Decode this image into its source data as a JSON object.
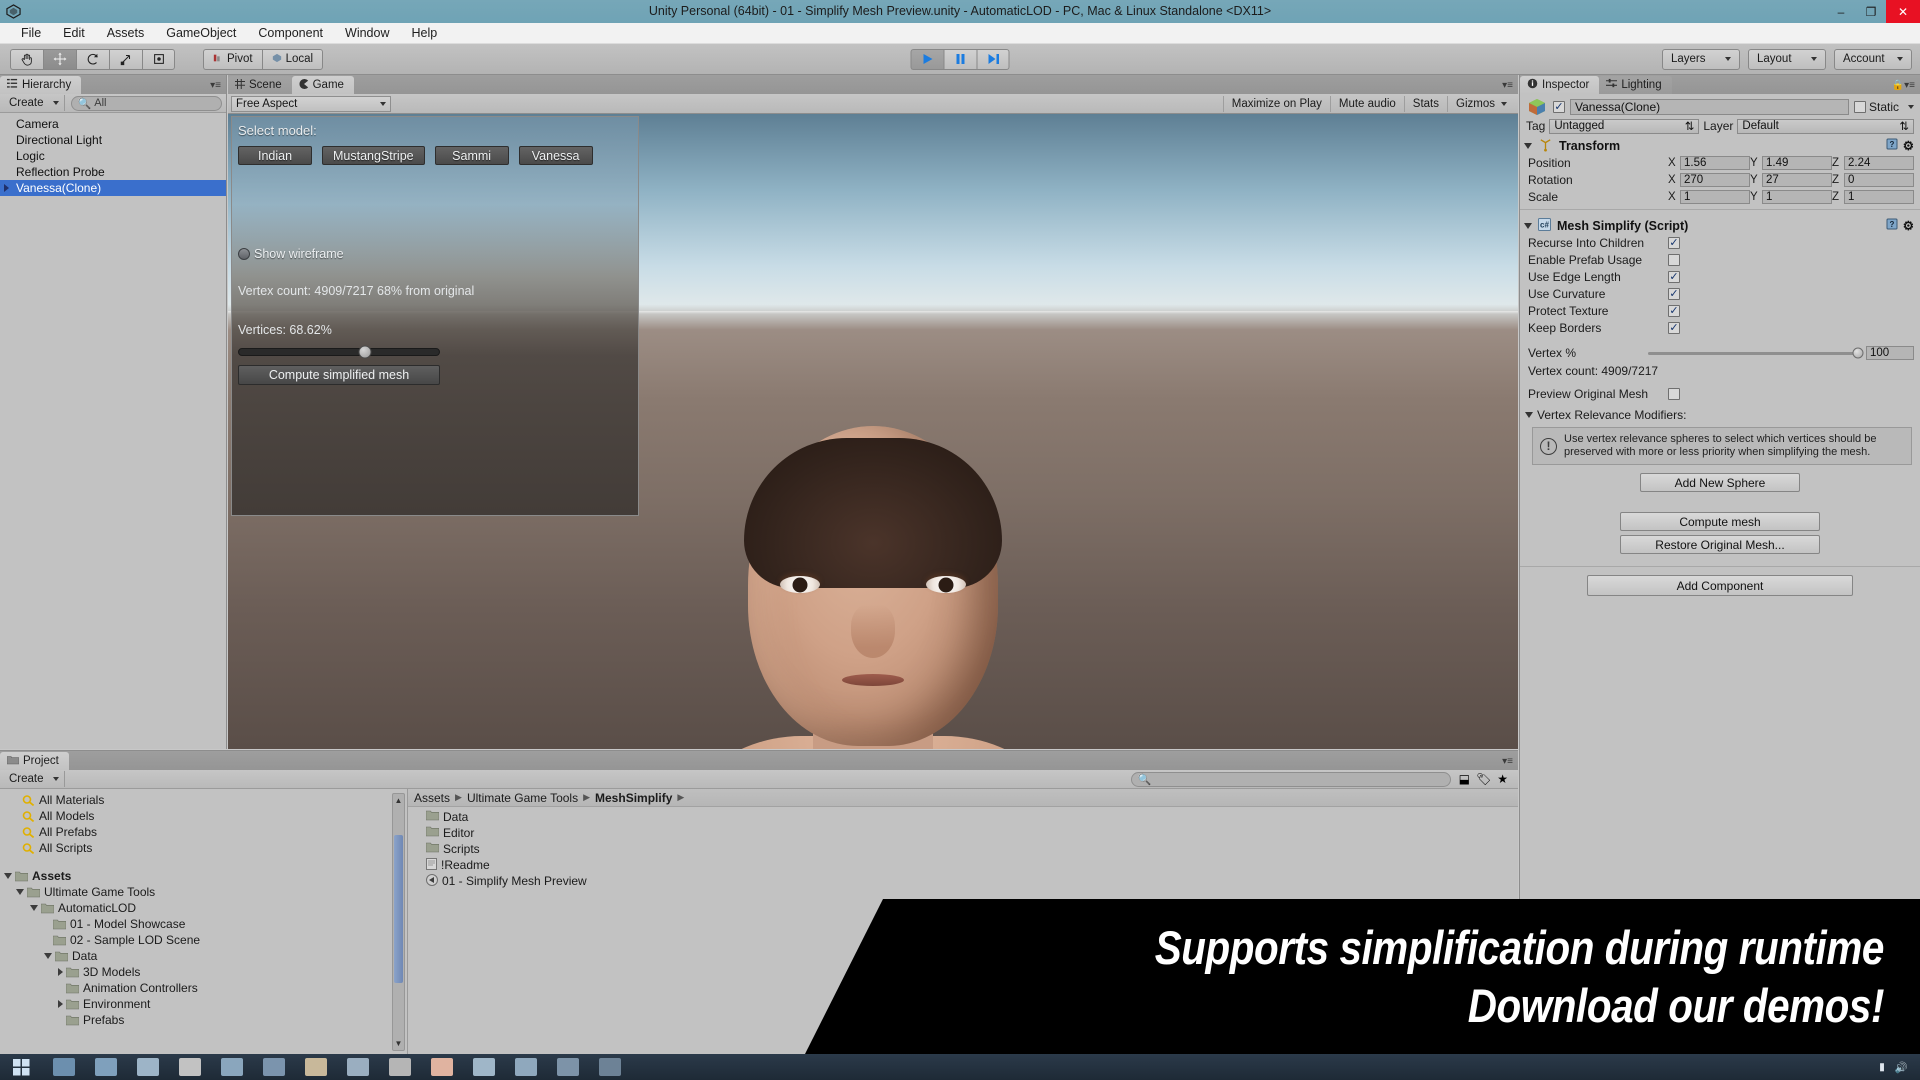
{
  "window": {
    "title": "Unity Personal (64bit) - 01 - Simplify Mesh Preview.unity - AutomaticLOD - PC, Mac & Linux Standalone <DX11>",
    "minimize": "–",
    "maximize": "❐",
    "close": "✕",
    "logo_icon": "unity-logo-icon"
  },
  "menubar": {
    "items": [
      "File",
      "Edit",
      "Assets",
      "GameObject",
      "Component",
      "Window",
      "Help"
    ]
  },
  "toolbar": {
    "tools": [
      {
        "name": "hand-tool",
        "glyph": "✋"
      },
      {
        "name": "move-tool",
        "glyph": "✛"
      },
      {
        "name": "rotate-tool",
        "glyph": "↺"
      },
      {
        "name": "scale-tool",
        "glyph": "⤢"
      },
      {
        "name": "rect-tool",
        "glyph": "▣"
      }
    ],
    "pivot_label": "Pivot",
    "local_label": "Local",
    "play_label": "▶",
    "pause_label": "❚❚",
    "step_label": "▶❚",
    "layers_label": "Layers",
    "layout_label": "Layout",
    "account_label": "Account"
  },
  "hierarchy": {
    "tab_label": "Hierarchy",
    "create_label": "Create",
    "search_placeholder": "All",
    "search_value": "",
    "items": [
      {
        "label": "Camera",
        "expandable": false,
        "selected": false
      },
      {
        "label": "Directional Light",
        "expandable": false,
        "selected": false
      },
      {
        "label": "Logic",
        "expandable": false,
        "selected": false
      },
      {
        "label": "Reflection Probe",
        "expandable": false,
        "selected": false
      },
      {
        "label": "Vanessa(Clone)",
        "expandable": true,
        "selected": true
      }
    ]
  },
  "gameview": {
    "tabs": [
      {
        "label": "Scene",
        "icon": "scene-grid-icon",
        "active": false
      },
      {
        "label": "Game",
        "icon": "game-pacman-icon",
        "active": true
      }
    ],
    "aspect_label": "Free Aspect",
    "right_toggles": [
      "Maximize on Play",
      "Mute audio",
      "Stats",
      "Gizmos"
    ],
    "overlay": {
      "select_model_label": "Select model:",
      "model_buttons": [
        "Indian",
        "MustangStripe",
        "Sammi",
        "Vanessa"
      ],
      "show_wireframe_label": "Show wireframe",
      "show_wireframe_checked": false,
      "vertex_count_text": "Vertex count: 4909/7217 68% from original",
      "vertices_label": "Vertices: 68.62%",
      "slider_percent": 68.62,
      "compute_button_label": "Compute simplified mesh"
    }
  },
  "inspector": {
    "tabs": [
      {
        "label": "Inspector",
        "icon": "info-circle-icon",
        "active": true
      },
      {
        "label": "Lighting",
        "icon": "lighting-icon",
        "active": false
      }
    ],
    "lock_icon": "lock-icon",
    "menu_icon": "panel-menu-icon",
    "object_enabled": true,
    "object_name": "Vanessa(Clone)",
    "static_label": "Static",
    "static_checked": false,
    "tag_label": "Tag",
    "tag_value": "Untagged",
    "layer_label": "Layer",
    "layer_value": "Default",
    "transform": {
      "title": "Transform",
      "help_icon": "help-book-icon",
      "gear_icon": "gear-icon",
      "rows": [
        {
          "label": "Position",
          "x": "1.56",
          "y": "1.49",
          "z": "2.24"
        },
        {
          "label": "Rotation",
          "x": "270",
          "y": "27",
          "z": "0"
        },
        {
          "label": "Scale",
          "x": "1",
          "y": "1",
          "z": "1"
        }
      ],
      "axis_labels": [
        "X",
        "Y",
        "Z"
      ]
    },
    "mesh_simplify": {
      "title": "Mesh Simplify (Script)",
      "script_icon": "csharp-script-icon",
      "help_icon": "help-book-icon",
      "gear_icon": "gear-icon",
      "checkboxes": [
        {
          "label": "Recurse Into Children",
          "checked": true
        },
        {
          "label": "Enable Prefab Usage",
          "checked": false
        },
        {
          "label": "Use Edge Length",
          "checked": true
        },
        {
          "label": "Use Curvature",
          "checked": true
        },
        {
          "label": "Protect Texture",
          "checked": true
        },
        {
          "label": "Keep Borders",
          "checked": true
        }
      ],
      "vertex_percent_label": "Vertex %",
      "vertex_percent_value": "100",
      "vertex_count_label": "Vertex count: 4909/7217",
      "preview_original_label": "Preview Original Mesh",
      "preview_original_checked": false,
      "vertex_relevance_label": "Vertex Relevance Modifiers:",
      "help_text": "Use vertex relevance spheres to select which vertices should be preserved with more or less priority when simplifying the mesh.",
      "add_sphere_label": "Add New Sphere",
      "compute_mesh_label": "Compute mesh",
      "restore_mesh_label": "Restore Original Mesh..."
    },
    "add_component_label": "Add Component"
  },
  "project": {
    "tab_label": "Project",
    "create_label": "Create",
    "search_placeholder": "",
    "search_value": "",
    "favorites": [
      {
        "label": "All Materials",
        "icon": "search-favorite-icon"
      },
      {
        "label": "All Models",
        "icon": "search-favorite-icon"
      },
      {
        "label": "All Prefabs",
        "icon": "search-favorite-icon"
      },
      {
        "label": "All Scripts",
        "icon": "search-favorite-icon"
      }
    ],
    "tree": [
      {
        "label": "Assets",
        "depth": 0,
        "state": "open",
        "bold": true
      },
      {
        "label": "Ultimate Game Tools",
        "depth": 1,
        "state": "open",
        "bold": false
      },
      {
        "label": "AutomaticLOD",
        "depth": 2,
        "state": "open",
        "bold": false
      },
      {
        "label": "01 - Model Showcase",
        "depth": 3,
        "state": "leaf",
        "bold": false
      },
      {
        "label": "02 - Sample LOD Scene",
        "depth": 3,
        "state": "leaf",
        "bold": false
      },
      {
        "label": "Data",
        "depth": 3,
        "state": "open",
        "bold": false
      },
      {
        "label": "3D Models",
        "depth": 4,
        "state": "closed",
        "bold": false
      },
      {
        "label": "Animation Controllers",
        "depth": 4,
        "state": "leaf",
        "bold": false
      },
      {
        "label": "Environment",
        "depth": 4,
        "state": "closed",
        "bold": false
      },
      {
        "label": "Prefabs",
        "depth": 4,
        "state": "leaf",
        "bold": false
      }
    ],
    "breadcrumb": [
      "Assets",
      "Ultimate Game Tools",
      "MeshSimplify"
    ],
    "assets": [
      {
        "label": "Data",
        "icon": "folder-icon"
      },
      {
        "label": "Editor",
        "icon": "folder-icon"
      },
      {
        "label": "Scripts",
        "icon": "folder-icon"
      },
      {
        "label": "!Readme",
        "icon": "text-file-icon"
      },
      {
        "label": "01 - Simplify Mesh Preview",
        "icon": "unity-scene-icon"
      }
    ]
  },
  "banner": {
    "line1": "Supports simplification during runtime",
    "line2": "Download our demos!"
  },
  "taskbar": {
    "start_icon": "windows-start-icon",
    "items": [
      "app-1",
      "app-2",
      "app-3",
      "app-4",
      "app-5",
      "app-6",
      "app-7",
      "app-8",
      "app-9",
      "app-10",
      "app-11",
      "app-12",
      "app-13",
      "app-14"
    ],
    "tray_icons": [
      "network-icon",
      "volume-icon"
    ]
  },
  "colors": {
    "title_bar": "#6fa3b5",
    "selection_blue": "#3a6fcc",
    "panel_gray": "#c2c2c2",
    "close_red": "#e81123"
  }
}
